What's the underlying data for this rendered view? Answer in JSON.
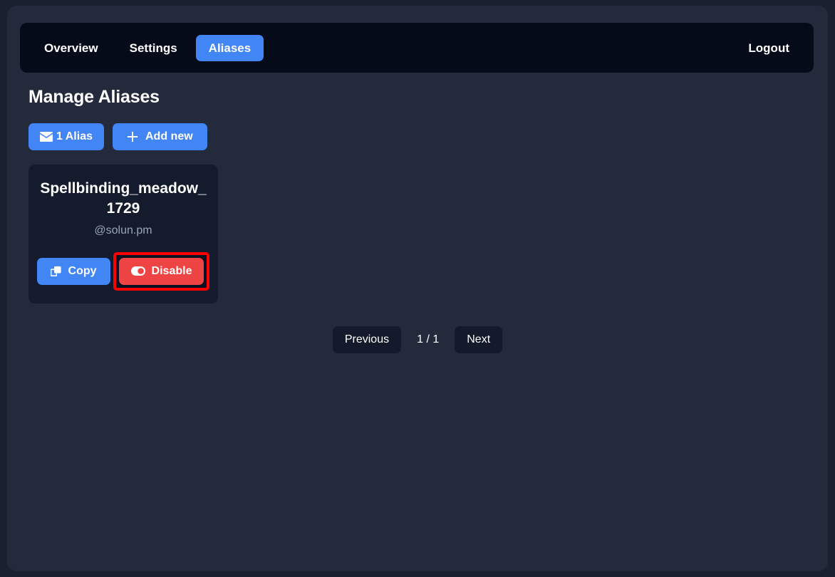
{
  "nav": {
    "items": [
      {
        "label": "Overview",
        "active": false
      },
      {
        "label": "Settings",
        "active": false
      },
      {
        "label": "Aliases",
        "active": true
      }
    ],
    "logout_label": "Logout"
  },
  "main": {
    "title": "Manage Aliases",
    "alias_count_label": "1 Alias",
    "alias_count_icon": "envelope-icon",
    "add_new_label": "Add new",
    "add_new_icon": "plus-icon",
    "cards": [
      {
        "name": "Spellbinding_meadow_1729",
        "domain": "@solun.pm",
        "copy_label": "Copy",
        "copy_icon": "copy-icon",
        "disable_label": "Disable",
        "disable_icon": "toggle-on-icon",
        "highlighted_action": "disable-button"
      }
    ]
  },
  "pagination": {
    "previous_label": "Previous",
    "indicator": "1 / 1",
    "next_label": "Next"
  },
  "colors": {
    "page_background": "#1b2030",
    "container_background": "#222a3c",
    "navbar_background": "#060b1a",
    "accent_blue": "#4285f4",
    "danger_red": "#ef4444",
    "card_background": "#141b2d",
    "muted_text": "#9aa6b8",
    "highlight_outline": "#ff0000"
  }
}
